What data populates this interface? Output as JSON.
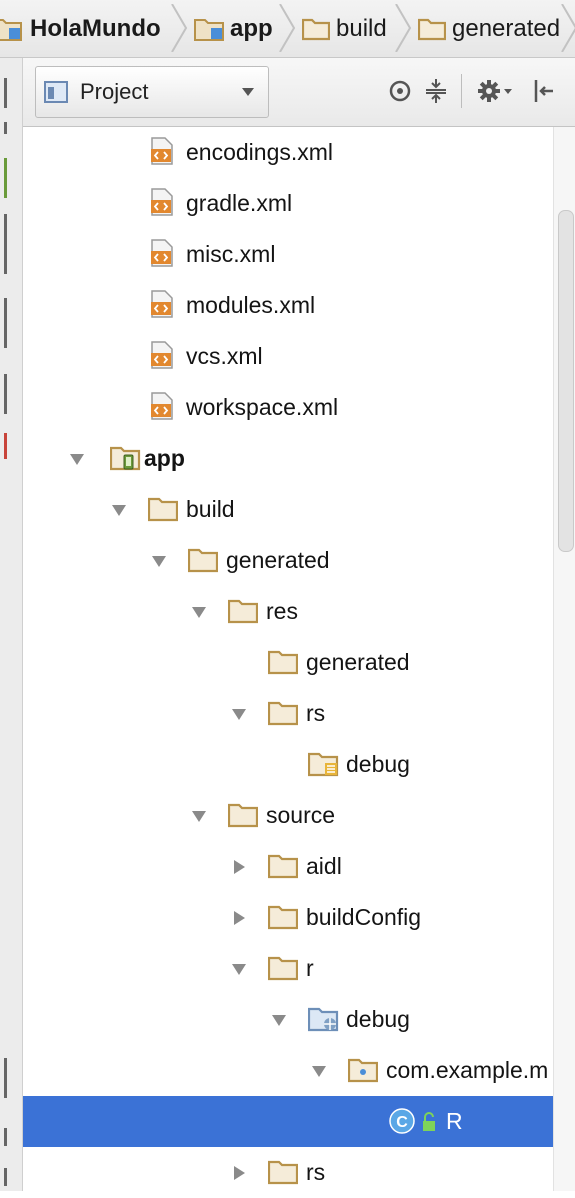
{
  "breadcrumbs": [
    {
      "label": "HolaMundo",
      "icon": "module-folder-icon"
    },
    {
      "label": "app",
      "icon": "module-folder-icon"
    },
    {
      "label": "build",
      "icon": "folder-icon"
    },
    {
      "label": "generated",
      "icon": "folder-icon"
    }
  ],
  "toolbar": {
    "view_label": "Project",
    "icons": [
      "locate-icon",
      "collapse-all-icon",
      "gear-icon",
      "hide-panel-icon"
    ]
  },
  "tree": [
    {
      "label": "encodings.xml",
      "icon": "xml-file-icon"
    },
    {
      "label": "gradle.xml",
      "icon": "xml-file-icon"
    },
    {
      "label": "misc.xml",
      "icon": "xml-file-icon"
    },
    {
      "label": "modules.xml",
      "icon": "xml-file-icon"
    },
    {
      "label": "vcs.xml",
      "icon": "xml-file-icon"
    },
    {
      "label": "workspace.xml",
      "icon": "xml-file-icon"
    },
    {
      "label": "app",
      "icon": "android-module-icon",
      "expanded": true
    },
    {
      "label": "build",
      "icon": "folder-icon",
      "expanded": true
    },
    {
      "label": "generated",
      "icon": "folder-icon",
      "expanded": true
    },
    {
      "label": "res",
      "icon": "folder-icon",
      "expanded": true
    },
    {
      "label": "generated",
      "icon": "folder-icon"
    },
    {
      "label": "rs",
      "icon": "folder-icon",
      "expanded": true
    },
    {
      "label": "debug",
      "icon": "resource-folder-icon"
    },
    {
      "label": "source",
      "icon": "folder-icon",
      "expanded": true
    },
    {
      "label": "aidl",
      "icon": "folder-icon",
      "expanded": false
    },
    {
      "label": "buildConfig",
      "icon": "folder-icon",
      "expanded": false
    },
    {
      "label": "r",
      "icon": "folder-icon",
      "expanded": true
    },
    {
      "label": "debug",
      "icon": "source-root-folder-icon",
      "expanded": true
    },
    {
      "label": "com.example.m",
      "icon": "package-icon",
      "expanded": true
    },
    {
      "label": "R",
      "icon": "class-icon",
      "selected": true
    },
    {
      "label": "rs",
      "icon": "folder-icon",
      "expanded": false
    }
  ],
  "colors": {
    "selection": "#3b72d6",
    "folder": "#c9a15a",
    "xml_badge": "#e2882f",
    "class_icon": "#3f8fd2"
  }
}
